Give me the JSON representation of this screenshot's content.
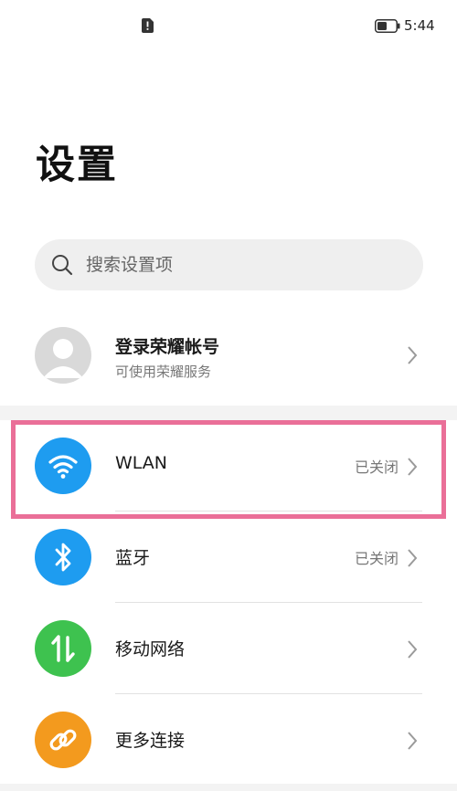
{
  "status_bar": {
    "time": "5:44",
    "icons": [
      "sim-alert-icon",
      "battery-icon"
    ]
  },
  "header": {
    "title": "设置"
  },
  "search": {
    "placeholder": "搜索设置项",
    "icon": "search-icon"
  },
  "account": {
    "name": "登录荣耀帐号",
    "subtitle": "可使用荣耀服务",
    "icon": "avatar-icon"
  },
  "connectivity": [
    {
      "label": "WLAN",
      "status": "已关闭",
      "icon": "wifi-icon",
      "color": "#1e9cf0",
      "highlighted": true
    },
    {
      "label": "蓝牙",
      "status": "已关闭",
      "icon": "bluetooth-icon",
      "color": "#1e9cf0",
      "highlighted": false
    },
    {
      "label": "移动网络",
      "status": "",
      "icon": "mobile-data-icon",
      "color": "#3ec24f",
      "highlighted": false
    },
    {
      "label": "更多连接",
      "status": "",
      "icon": "link-icon",
      "color": "#f39a1e",
      "highlighted": false
    }
  ],
  "colors": {
    "highlight_frame": "#ea6f98",
    "background": "#ffffff",
    "search_bg": "#efefef"
  }
}
